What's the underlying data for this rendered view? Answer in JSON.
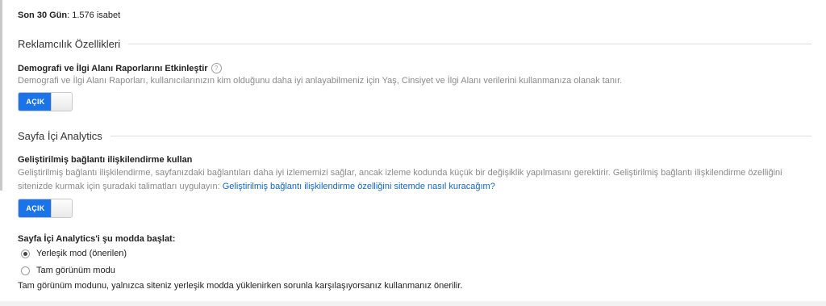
{
  "summary": {
    "label": "Son 30 Gün",
    "value": ": 1.576 isabet"
  },
  "advertising": {
    "heading": "Reklamcılık Özellikleri",
    "demographics": {
      "title": "Demografi ve İlgi Alanı Raporlarını Etkinleştir",
      "help_icon": "?",
      "description": "Demografi ve İlgi Alanı Raporları, kullanıcılarınızın kim olduğunu daha iyi anlayabilmeniz için Yaş, Cinsiyet ve İlgi Alanı verilerini kullanmanıza olanak tanır.",
      "toggle_label": "AÇIK"
    }
  },
  "inpage": {
    "heading": "Sayfa İçi Analytics",
    "enhanced_link": {
      "title": "Geliştirilmiş bağlantı ilişkilendirme kullan",
      "description": "Geliştirilmiş bağlantı ilişkilendirme, sayfanızdaki bağlantıları daha iyi izlememizi sağlar, ancak izleme kodunda küçük bir değişiklik yapılmasını gerektirir. Geliştirilmiş bağlantı ilişkilendirme özelliğini sitenizde kurmak için şuradaki talimatları uygulayın: ",
      "link_text": "Geliştirilmiş bağlantı ilişkilendirme özelliğini sitemde nasıl kuracağım?",
      "toggle_label": "AÇIK"
    },
    "mode": {
      "title": "Sayfa İçi Analytics'i şu modda başlat:",
      "options": [
        {
          "label": "Yerleşik mod (önerilen)",
          "selected": true
        },
        {
          "label": "Tam görünüm modu",
          "selected": false
        }
      ],
      "note": "Tam görünüm modunu, yalnızca siteniz yerleşik modda yüklenirken sorunla karşılaşıyorsanız kullanmanız önerilir."
    }
  },
  "colors": {
    "toggle_on": "#1a73e8",
    "link": "#1565c0"
  }
}
